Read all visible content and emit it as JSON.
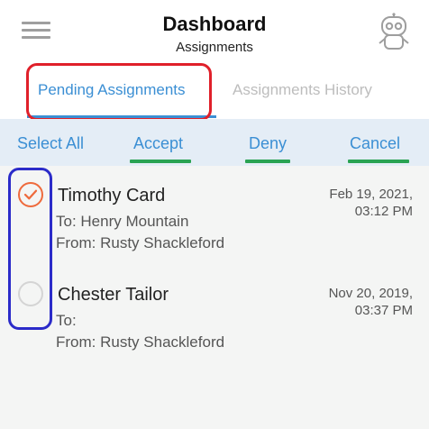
{
  "header": {
    "title": "Dashboard",
    "subtitle": "Assignments",
    "left_icon": "menu-icon",
    "right_icon": "robot-avatar-icon"
  },
  "tabs": [
    {
      "label": "Pending Assignments",
      "active": true
    },
    {
      "label": "Assignments History",
      "active": false
    }
  ],
  "actions": {
    "select_all": "Select All",
    "accept": "Accept",
    "deny": "Deny",
    "cancel": "Cancel"
  },
  "assignments": [
    {
      "name": "Timothy Card",
      "to": "To: Henry Mountain",
      "from": "From: Rusty Shackleford",
      "date": "Feb 19, 2021,",
      "time": "03:12 PM",
      "selected": true
    },
    {
      "name": "Chester Tailor",
      "to": "To:",
      "from": "From: Rusty Shackleford",
      "date": "Nov 20, 2019,",
      "time": "03:37 PM",
      "selected": false
    }
  ],
  "colors": {
    "accent": "#3b8fd4",
    "check_selected": "#ee6a3c",
    "annotation_red": "#e0202a",
    "annotation_green": "#2aa353",
    "annotation_blue": "#2b2bc9",
    "action_bar_bg": "#e4edf6"
  }
}
